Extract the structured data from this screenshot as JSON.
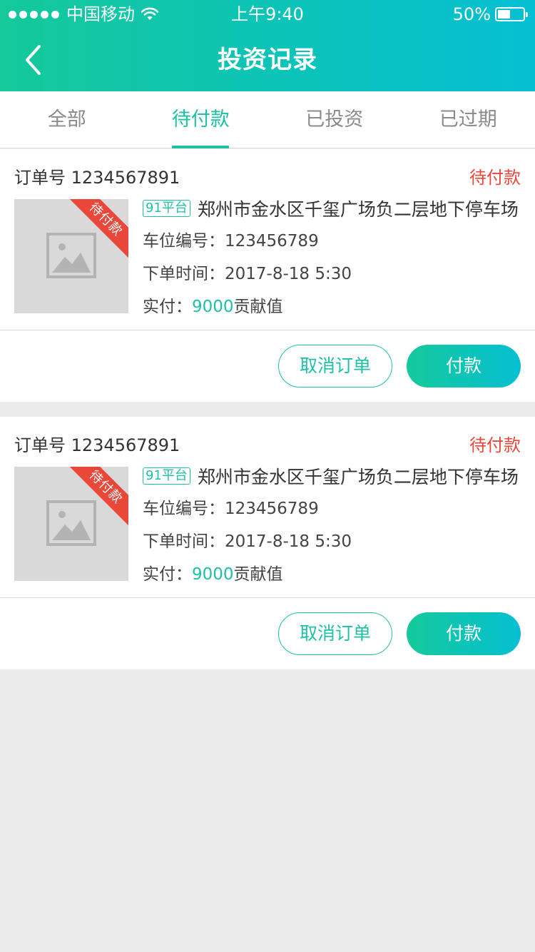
{
  "status_bar": {
    "carrier": "中国移动",
    "time": "上午9:40",
    "battery": "50%",
    "battery_level": 0.5,
    "signal_bars": 5
  },
  "nav": {
    "back_icon": "chevron-left-icon",
    "title": "投资记录"
  },
  "tabs": [
    {
      "label": "全部",
      "active": false
    },
    {
      "label": "待付款",
      "active": true
    },
    {
      "label": "已投资",
      "active": false
    },
    {
      "label": "已过期",
      "active": false
    }
  ],
  "orders": [
    {
      "order_label": "订单号 1234567891",
      "status": "待付款",
      "ribbon": "待付款",
      "platform": "91平台",
      "location": "郑州市金水区千玺广场负二层地下停车场",
      "spot_label": "车位编号：",
      "spot_value": "123456789",
      "time_label": "下单时间：",
      "time_value": "2017-8-18 5:30",
      "paid_label": "实付：",
      "paid_value": "9000",
      "paid_unit": "贡献值",
      "cancel_label": "取消订单",
      "pay_label": "付款"
    },
    {
      "order_label": "订单号 1234567891",
      "status": "待付款",
      "ribbon": "待付款",
      "platform": "91平台",
      "location": "郑州市金水区千玺广场负二层地下停车场",
      "spot_label": "车位编号：",
      "spot_value": "123456789",
      "time_label": "下单时间：",
      "time_value": "2017-8-18 5:30",
      "paid_label": "实付：",
      "paid_value": "9000",
      "paid_unit": "贡献值",
      "cancel_label": "取消订单",
      "pay_label": "付款"
    }
  ],
  "colors": {
    "accent": "#1ec1a6",
    "status_red": "#e8473a",
    "header_gradient_start": "#15c99a",
    "header_gradient_end": "#06bfd3",
    "background": "#ececec"
  }
}
